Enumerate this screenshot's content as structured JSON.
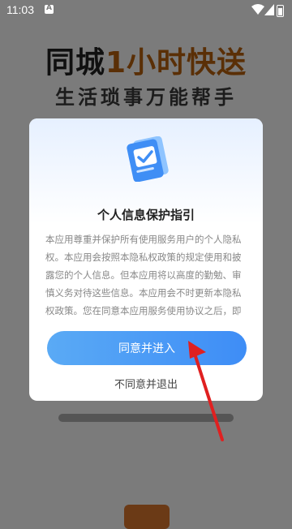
{
  "status_bar": {
    "time": "11:03",
    "icons": [
      "notification-icon",
      "wifi-icon",
      "signal-icon",
      "battery-icon"
    ]
  },
  "background": {
    "title_part1": "同城",
    "title_highlight": "1小时快送",
    "subtitle": "生活琐事万能帮手"
  },
  "dialog": {
    "title": "个人信息保护指引",
    "body": "本应用尊重并保护所有使用服务用户的个人隐私权。本应用会按照本隐私权政策的规定使用和披露您的个人信息。但本应用将以高度的勤勉、审慎义务对待这些信息。本应用会不时更新本隐私权政策。您在同意本应用服务使用协议之后，即视为您已经同意本隐私权政策全部内容。",
    "agree_label": "同意并进入",
    "disagree_label": "不同意并退出",
    "accent_color": "#3e8df6"
  },
  "annotation": {
    "arrow_color": "#e02020"
  }
}
